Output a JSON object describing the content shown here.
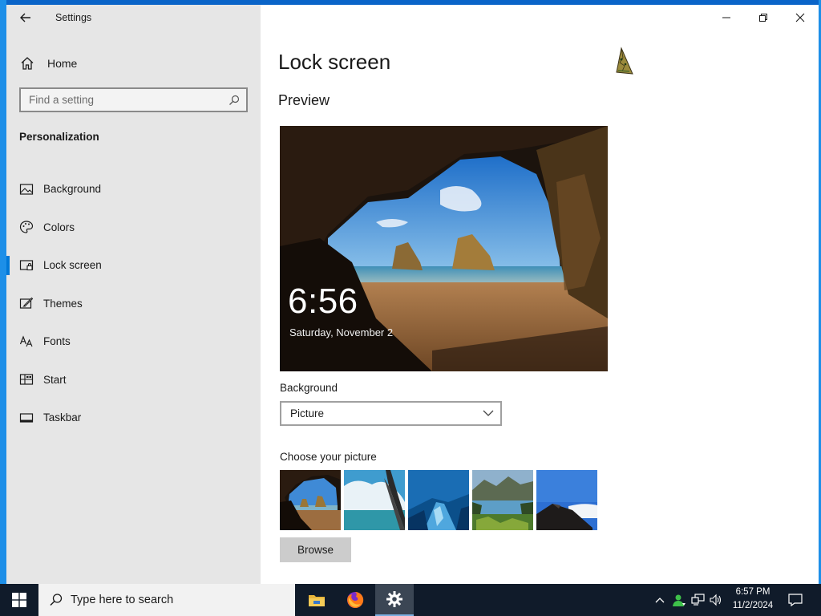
{
  "window": {
    "app_title": "Settings",
    "controls": [
      "minimize",
      "restore",
      "close"
    ]
  },
  "sidebar": {
    "home_label": "Home",
    "search_placeholder": "Find a setting",
    "section_title": "Personalization",
    "items": [
      {
        "label": "Background",
        "icon": "background-icon",
        "active": false
      },
      {
        "label": "Colors",
        "icon": "colors-icon",
        "active": false
      },
      {
        "label": "Lock screen",
        "icon": "lock-screen-icon",
        "active": true
      },
      {
        "label": "Themes",
        "icon": "themes-icon",
        "active": false
      },
      {
        "label": "Fonts",
        "icon": "fonts-icon",
        "active": false
      },
      {
        "label": "Start",
        "icon": "start-icon",
        "active": false
      },
      {
        "label": "Taskbar",
        "icon": "taskbar-icon",
        "active": false
      }
    ]
  },
  "main": {
    "page_title": "Lock screen",
    "preview_title": "Preview",
    "preview_time": "6:56",
    "preview_date": "Saturday, November 2",
    "background_label": "Background",
    "background_value": "Picture",
    "choose_label": "Choose your picture",
    "thumbnails": [
      "cave-beach",
      "clouds-plane-wing",
      "ice-cave",
      "mountain-lake",
      "cliff-sky"
    ],
    "browse_label": "Browse"
  },
  "taskbar": {
    "search_text": "Type here to search",
    "apps": [
      "file-explorer",
      "firefox",
      "settings"
    ],
    "time": "6:57 PM",
    "date": "11/2/2024"
  },
  "colors": {
    "accent": "#0078d7",
    "sidebar_bg": "#e6e6e6",
    "taskbar_bg": "#101b2a"
  }
}
